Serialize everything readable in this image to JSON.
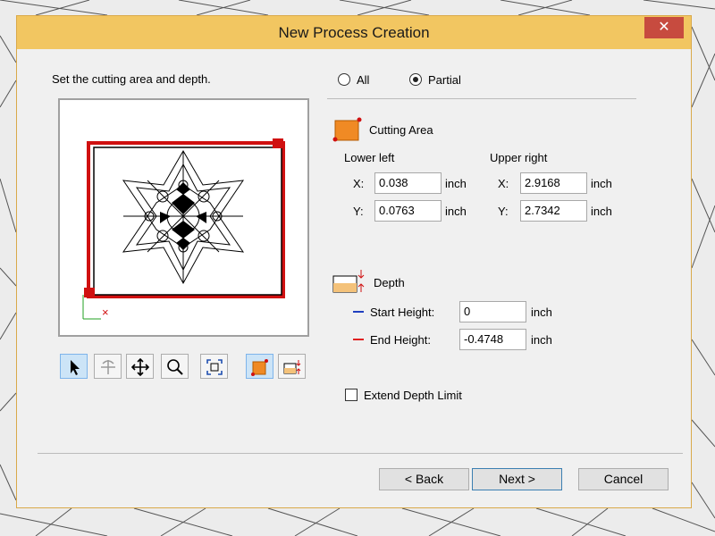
{
  "dialog": {
    "title": "New Process Creation",
    "close_glyph": "✕",
    "instruction": "Set the cutting area and depth."
  },
  "mode": {
    "all_label": "All",
    "partial_label": "Partial",
    "selected": "Partial"
  },
  "cutting_area": {
    "heading": "Cutting Area",
    "lower_left_label": "Lower left",
    "upper_right_label": "Upper right",
    "x_label": "X:",
    "y_label": "Y:",
    "lower_left_x": "0.038",
    "lower_left_y": "0.0763",
    "upper_right_x": "2.9168",
    "upper_right_y": "2.7342",
    "unit": "inch"
  },
  "depth": {
    "heading": "Depth",
    "start_label": "Start Height:",
    "start_value": "0",
    "start_color": "#1f3fbf",
    "end_label": "End Height:",
    "end_value": "-0.4748",
    "end_color": "#e02020",
    "unit": "inch"
  },
  "extend_depth": {
    "label": "Extend Depth Limit",
    "checked": false
  },
  "toolbar": {
    "icons": [
      "select-arrow-icon",
      "rotate-view-icon",
      "pan-icon",
      "zoom-icon",
      "fit-view-icon",
      "cutting-area-icon",
      "depth-icon"
    ]
  },
  "buttons": {
    "back": "< Back",
    "next": "Next >",
    "cancel": "Cancel"
  },
  "preview": {
    "x_axis_glyph": "×"
  },
  "colors": {
    "title_bar": "#f2c661",
    "close_button": "#c74b3f",
    "area_outline": "#d01010",
    "area_icon_fill": "#f08a24"
  }
}
